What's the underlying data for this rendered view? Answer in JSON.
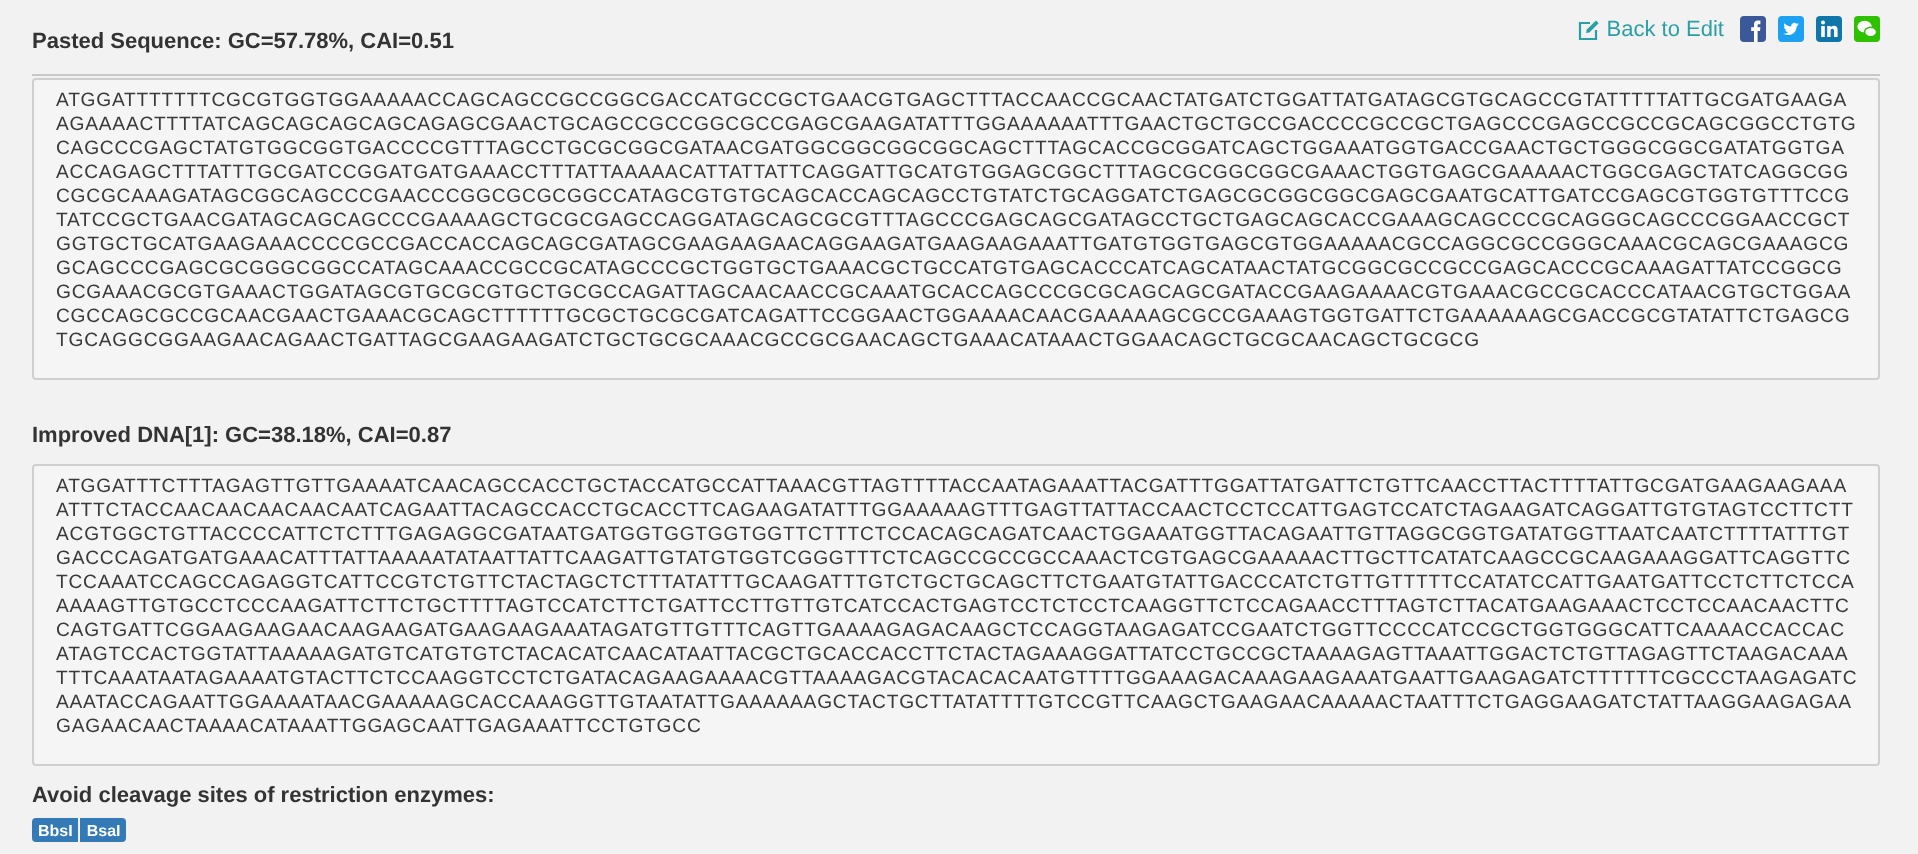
{
  "header": {
    "title": "Pasted Sequence: GC=57.78%, CAI=0.51",
    "back_link": "Back to Edit",
    "share_buttons": [
      {
        "kind": "facebook"
      },
      {
        "kind": "twitter"
      },
      {
        "kind": "linkedin"
      },
      {
        "kind": "wechat"
      }
    ]
  },
  "pasted_sequence": {
    "sequence": "ATGGATTTTTTTCGCGTGGTGGAAAAACCAGCAGCCGCCGGCGACCATGCCGCTGAACGTGAGCTTTACCAACCGCAACTATGATCTGGATTATGATAGCGTGCAGCCGTATTTTTATTGCGATGAAGAAGAAAACTTTTATCAGCAGCAGCAGCAGAGCGAACTGCAGCCGCCGGCGCCGAGCGAAGATATTTGGAAAAAATTTGAACTGCTGCCGACCCCGCCGCTGAGCCCGAGCCGCCGCAGCGGCCTGTGCAGCCCGAGCTATGTGGCGGTGACCCCGTTTAGCCTGCGCGGCGATAACGATGGCGGCGGCGGCAGCTTTAGCACCGCGGATCAGCTGGAAATGGTGACCGAACTGCTGGGCGGCGATATGGTGAACCAGAGCTTTATTTGCGATCCGGATGATGAAACCTTTATTAAAAACATTATTATTCAGGATTGCATGTGGAGCGGCTTTAGCGCGGCGGCGAAACTGGTGAGCGAAAAACTGGCGAGCTATCAGGCGGCGCGCAAAGATAGCGGCAGCCCGAACCCGGCGCGCGGCCATAGCGTGTGCAGCACCAGCAGCCTGTATCTGCAGGATCTGAGCGCGGCGGCGAGCGAATGCATTGATCCGAGCGTGGTGTTTCCGTATCCGCTGAACGATAGCAGCAGCCCGAAAAGCTGCGCGAGCCAGGATAGCAGCGCGTTTAGCCCGAGCAGCGATAGCCTGCTGAGCAGCACCGAAAGCAGCCCGCAGGGCAGCCCGGAACCGCTGGTGCTGCATGAAGAAACCCCGCCGACCACCAGCAGCGATAGCGAAGAAGAACAGGAAGATGAAGAAGAAATTGATGTGGTGAGCGTGGAAAAACGCCAGGCGCCGGGCAAACGCAGCGAAAGCGGCAGCCCGAGCGCGGGCGGCCATAGCAAACCGCCGCATAGCCCGCTGGTGCTGAAACGCTGCCATGTGAGCACCCATCAGCATAACTATGCGGCGCCGCCGAGCACCCGCAAAGATTATCCGGCGGCGAAACGCGTGAAACTGGATAGCGTGCGCGTGCTGCGCCAGATTAGCAACAACCGCAAATGCACCAGCCCGCGCAGCAGCGATACCGAAGAAAACGTGAAACGCCGCACCCATAACGTGCTGGAACGCCAGCGCCGCAACGAACTGAAACGCAGCTTTTTTGCGCTGCGCGATCAGATTCCGGAACTGGAAAACAACGAAAAAGCGCCGAAAGTGGTGATTCTGAAAAAAGCGACCGCGTATATTCTGAGCGTGCAGGCGGAAGAACAGAACTGATTAGCGAAGAAGATCTGCTGCGCAAACGCCGCGAACAGCTGAAACATAAACTGGAACAGCTGCGCAACAGCTGCGCG"
  },
  "improved_dna": {
    "title": "Improved DNA[1]: GC=38.18%, CAI=0.87",
    "sequence": "ATGGATTTCTTTAGAGTTGTTGAAAATCAACAGCCACCTGCTACCATGCCATTAAACGTTAGTTTTACCAATAGAAATTACGATTTGGATTATGATTCTGTTCAACCTTACTTTTATTGCGATGAAGAAGAAAATTTCTACCAACAACAACAACAATCAGAATTACAGCCACCTGCACCTTCAGAAGATATTTGGAAAAAGTTTGAGTTATTACCAACTCCTCCATTGAGTCCATCTAGAAGATCAGGATTGTGTAGTCCTTCTTACGTGGCTGTTACCCCATTCTCTTTGAGAGGCGATAATGATGGTGGTGGTGGTTCTTTCTCCACAGCAGATCAACTGGAAATGGTTACAGAATTGTTAGGCGGTGATATGGTTAATCAATCTTTTATTTGTGACCCAGATGATGAAACATTTATTAAAAATATAATTATTCAAGATTGTATGTGGTCGGGTTTCTCAGCCGCCGCCAAACTCGTGAGCGAAAAACTTGCTTCATATCAAGCCGCAAGAAAGGATTCAGGTTCTCCAAATCCAGCCAGAGGTCATTCCGTCTGTTCTACTAGCTCTTTATATTTGCAAGATTTGTCTGCTGCAGCTTCTGAATGTATTGACCCATCTGTTGTTTTTCCATATCCATTGAATGATTCCTCTTCTCCAAAAAGTTGTGCCTCCCAAGATTCTTCTGCTTTTAGTCCATCTTCTGATTCCTTGTTGTCATCCACTGAGTCCTCTCCTCAAGGTTCTCCAGAACCTTTAGTCTTACATGAAGAAACTCCTCCAACAACTTCCAGTGATTCGGAAGAAGAACAAGAAGATGAAGAAGAAATAGATGTTGTTTCAGTTGAAAAGAGACAAGCTCCAGGTAAGAGATCCGAATCTGGTTCCCCATCCGCTGGTGGGCATTCAAAACCACCACATAGTCCACTGGTATTAAAAAGATGTCATGTGTCTACACATCAACATAATTACGCTGCACCACCTTCTACTAGAAAGGATTATCCTGCCGCTAAAAGAGTTAAATTGGACTCTGTTAGAGTTCTAAGACAAATTTCAAATAATAGAAAATGTACTTCTCCAAGGTCCTCTGATACAGAAGAAAACGTTAAAAGACGTACACACAATGTTTTGGAAAGACAAAGAAGAAATGAATTGAAGAGATCTTTTTTCGCCCTAAGAGATCAAATACCAGAATTGGAAAATAACGAAAAAGCACCAAAGGTTGTAATATTGAAAAAAGCTACTGCTTATATTTTGTCCGTTCAAGCTGAAGAACAAAAACTAATTTCTGAGGAAGATCTATTAAGGAAGAGAAGAGAACAACTAAAACATAAATTGGAGCAATTGAGAAATTCCTGTGCC"
  },
  "restriction_enzymes": {
    "title": "Avoid cleavage sites of restriction enzymes:",
    "enzymes": [
      "BbsI",
      "BsaI"
    ]
  }
}
